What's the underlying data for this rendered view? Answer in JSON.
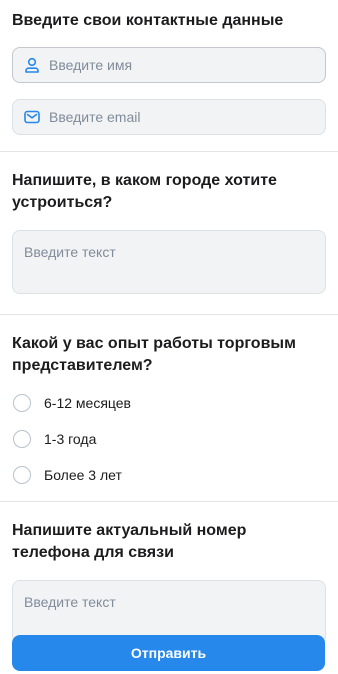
{
  "contacts": {
    "title": "Введите свои контактные данные",
    "name_placeholder": "Введите имя",
    "email_placeholder": "Введите email"
  },
  "city": {
    "title": "Напишите, в каком городе хотите устроиться?",
    "placeholder": "Введите текст"
  },
  "experience": {
    "title": "Какой у вас опыт работы торговым представителем?",
    "options": [
      "6-12 месяцев",
      "1-3 года",
      "Более 3 лет"
    ]
  },
  "phone": {
    "title": "Напишите актуальный номер телефона для связи",
    "placeholder": "Введите текст"
  },
  "submit_label": "Отправить",
  "colors": {
    "accent": "#2688eb",
    "field_bg": "#f2f3f5",
    "placeholder": "#818c99",
    "icon": "#2688eb"
  },
  "icons": {
    "name_field": "user-icon",
    "email_field": "mail-icon"
  }
}
